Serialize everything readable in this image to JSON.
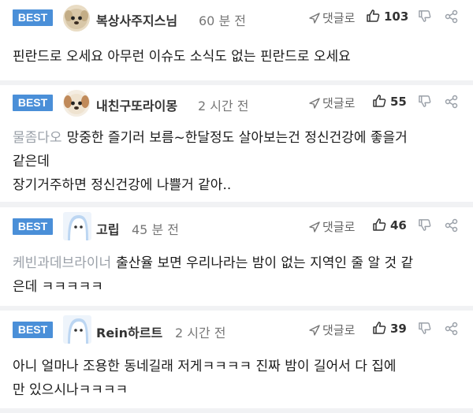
{
  "comments": [
    {
      "badge": "BEST",
      "avatar": "dog-avatar",
      "nickname": "복상사주지스님",
      "time": "60 분 전",
      "reply_label": "댓글로",
      "likes": "103",
      "reference": "",
      "text_lines": [
        "핀란드로 오세요 아무런 이슈도 소식도 없는 핀란드로 오세요"
      ]
    },
    {
      "badge": "BEST",
      "avatar": "dog-avatar",
      "nickname": "내친구또라이몽",
      "time": "2 시간 전",
      "reply_label": "댓글로",
      "likes": "55",
      "reference": "물좀다오",
      "text_lines": [
        "망중한 즐기러 보름~한달정도 살아보는건 정신건강에 좋을거",
        "같은데",
        "장기거주하면 정신건강에 나쁠거 같아.."
      ]
    },
    {
      "badge": "BEST",
      "avatar": "ghost-avatar",
      "nickname": "고립",
      "time": "45 분 전",
      "reply_label": "댓글로",
      "likes": "46",
      "reference": "케빈과데브라이너",
      "text_lines": [
        "출산율 보면 우리나라는 밤이 없는 지역인 줄 알 것 같",
        "은데 ㅋㅋㅋㅋㅋ"
      ]
    },
    {
      "badge": "BEST",
      "avatar": "ghost-avatar",
      "nickname": "Rein하르트",
      "time": "2 시간 전",
      "reply_label": "댓글로",
      "likes": "39",
      "reference": "",
      "text_lines": [
        "아니 얼마나 조용한 동네길래 저게ㅋㅋㅋㅋ 진짜 밤이 길어서 다 집에",
        "만 있으시나ㅋㅋㅋㅋ"
      ]
    }
  ]
}
